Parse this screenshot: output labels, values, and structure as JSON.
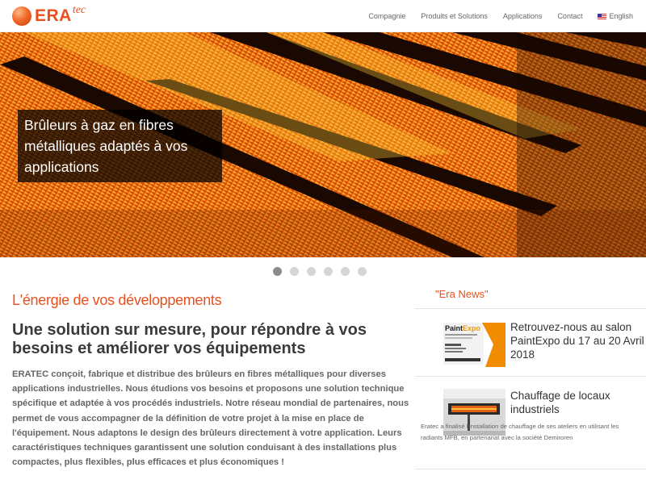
{
  "header": {
    "logo": {
      "brand": "ERA",
      "suffix": "tec"
    },
    "nav": [
      {
        "label": "Compagnie"
      },
      {
        "label": "Produits et Solutions"
      },
      {
        "label": "Applications"
      },
      {
        "label": "Contact"
      },
      {
        "label": "English",
        "icon": "us-flag-icon"
      }
    ]
  },
  "hero": {
    "caption": "Brûleurs à gaz en fibres métalliques adaptés à vos applications",
    "slide_count": 6,
    "active_slide": 1
  },
  "main": {
    "tagline": "L'énergie de vos développements",
    "headline": "Une solution sur mesure, pour répondre à vos besoins et améliorer vos équipements",
    "body": "ERATEC conçoit, fabrique et distribue des brûleurs en fibres métalliques pour diverses applications industrielles. Nous étudions vos besoins et proposons une solution technique spécifique et adaptée à vos procédés industriels. Notre réseau mondial de partenaires, nous permet de vous accompagner de la définition de votre projet à la mise en place de l'équipement. Nous adaptons le design des brûleurs directement à votre application. Leurs caractéristiques techniques garantissent une solution conduisant à des installations  plus compactes, plus flexibles, plus efficaces et plus économiques !"
  },
  "sidebar": {
    "title": "\"Era News\"",
    "news": [
      {
        "heading": "Retrouvez-nous au salon PaintExpo du 17 au 20 Avril 2018",
        "thumb_brand": "PaintExpo"
      },
      {
        "heading": "Chauffage de locaux industriels",
        "description": "Eratec a finalisé l'installation de chauffage de ses ateliers en utilisant les radiants MFB, en partenariat avec la société Demiroren"
      }
    ]
  },
  "colors": {
    "accent": "#e8501e",
    "text_dark": "#3b3b3b",
    "text_muted": "#666666"
  }
}
